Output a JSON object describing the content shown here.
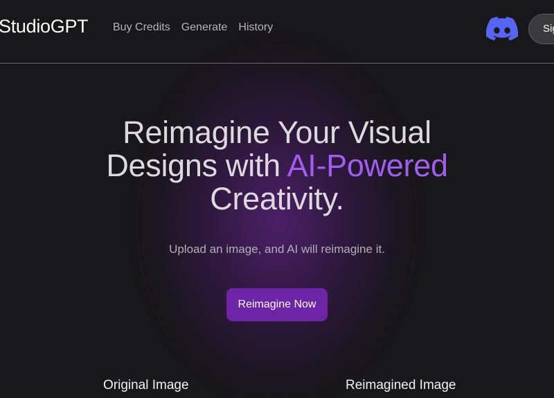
{
  "header": {
    "logo": "StudioGPT",
    "nav": [
      "Buy Credits",
      "Generate",
      "History"
    ],
    "signin_label": "Sign In",
    "discord_icon": "discord-icon"
  },
  "hero": {
    "title_line1": "Reimagine Your Visual",
    "title_line2_prefix": "Designs with ",
    "title_line2_accent": "AI-Powered",
    "title_line3": "Creativity.",
    "subtitle": "Upload an image, and AI will reimagine it.",
    "cta_label": "Reimagine Now"
  },
  "comparison": {
    "original_label": "Original Image",
    "reimagined_label": "Reimagined Image"
  },
  "colors": {
    "background": "#18171a",
    "accent": "#a35cf0",
    "button": "#6d24a6",
    "discord": "#5865f2"
  }
}
